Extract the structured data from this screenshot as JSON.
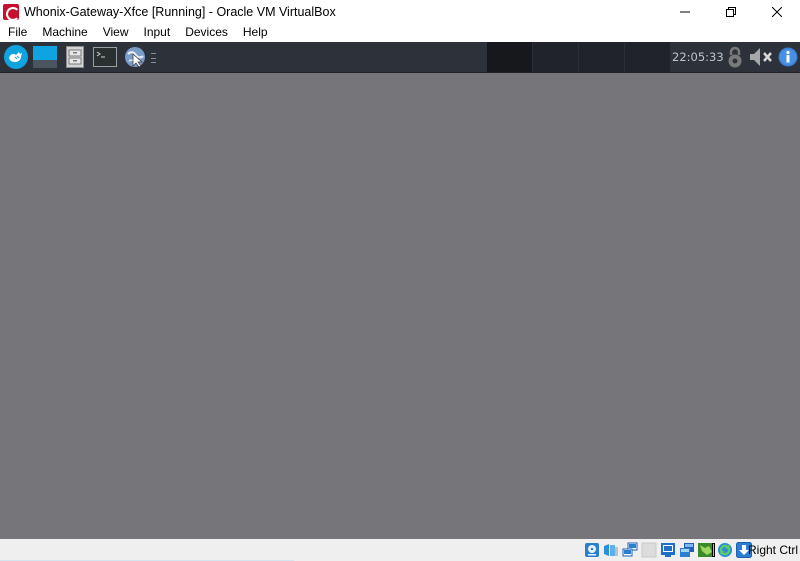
{
  "window": {
    "title": "Whonix-Gateway-Xfce [Running] - Oracle VM VirtualBox",
    "controls": {
      "minimize": "minimize-icon",
      "restore": "restore-icon",
      "close": "close-icon"
    }
  },
  "menubar": {
    "items": [
      {
        "label": "File"
      },
      {
        "label": "Machine"
      },
      {
        "label": "View"
      },
      {
        "label": "Input"
      },
      {
        "label": "Devices"
      },
      {
        "label": "Help"
      }
    ]
  },
  "vm_panel": {
    "launchers": [
      {
        "name": "whonix-menu",
        "icon": "whonix-logo-icon"
      },
      {
        "name": "show-desktop",
        "icon": "desktop-icon"
      },
      {
        "name": "file-manager",
        "icon": "file-cabinet-icon"
      },
      {
        "name": "terminal",
        "icon": "terminal-icon"
      },
      {
        "name": "web-browser",
        "icon": "globe-browser-icon"
      }
    ],
    "workspaces": [
      {
        "index": 1,
        "active": true
      },
      {
        "index": 2,
        "active": false
      },
      {
        "index": 3,
        "active": false
      },
      {
        "index": 4,
        "active": false
      }
    ],
    "clock": "22:05:33",
    "tray": [
      {
        "name": "lock",
        "icon": "lock-icon"
      },
      {
        "name": "volume-muted",
        "icon": "speaker-muted-icon"
      },
      {
        "name": "info",
        "icon": "info-icon"
      }
    ]
  },
  "colors": {
    "panel_bg": "#2d313a",
    "desktop_bg": "#76757a",
    "accent_blue": "#0fa3df",
    "statusbar_bg": "#efefef"
  },
  "statusbar": {
    "icons": [
      {
        "name": "hard-disk",
        "icon": "hard-disk-icon"
      },
      {
        "name": "optical-drive",
        "icon": "optical-drive-icon"
      },
      {
        "name": "network",
        "icon": "network-icon"
      },
      {
        "name": "usb",
        "icon": "usb-icon"
      },
      {
        "name": "shared-folders",
        "icon": "shared-folders-icon"
      },
      {
        "name": "display",
        "icon": "display-icon"
      },
      {
        "name": "video-capture",
        "icon": "video-capture-icon"
      },
      {
        "name": "mouse-integration",
        "icon": "mouse-integration-icon"
      },
      {
        "name": "keyboard-capture",
        "icon": "keyboard-capture-icon"
      }
    ],
    "host_key": "Right Ctrl"
  }
}
